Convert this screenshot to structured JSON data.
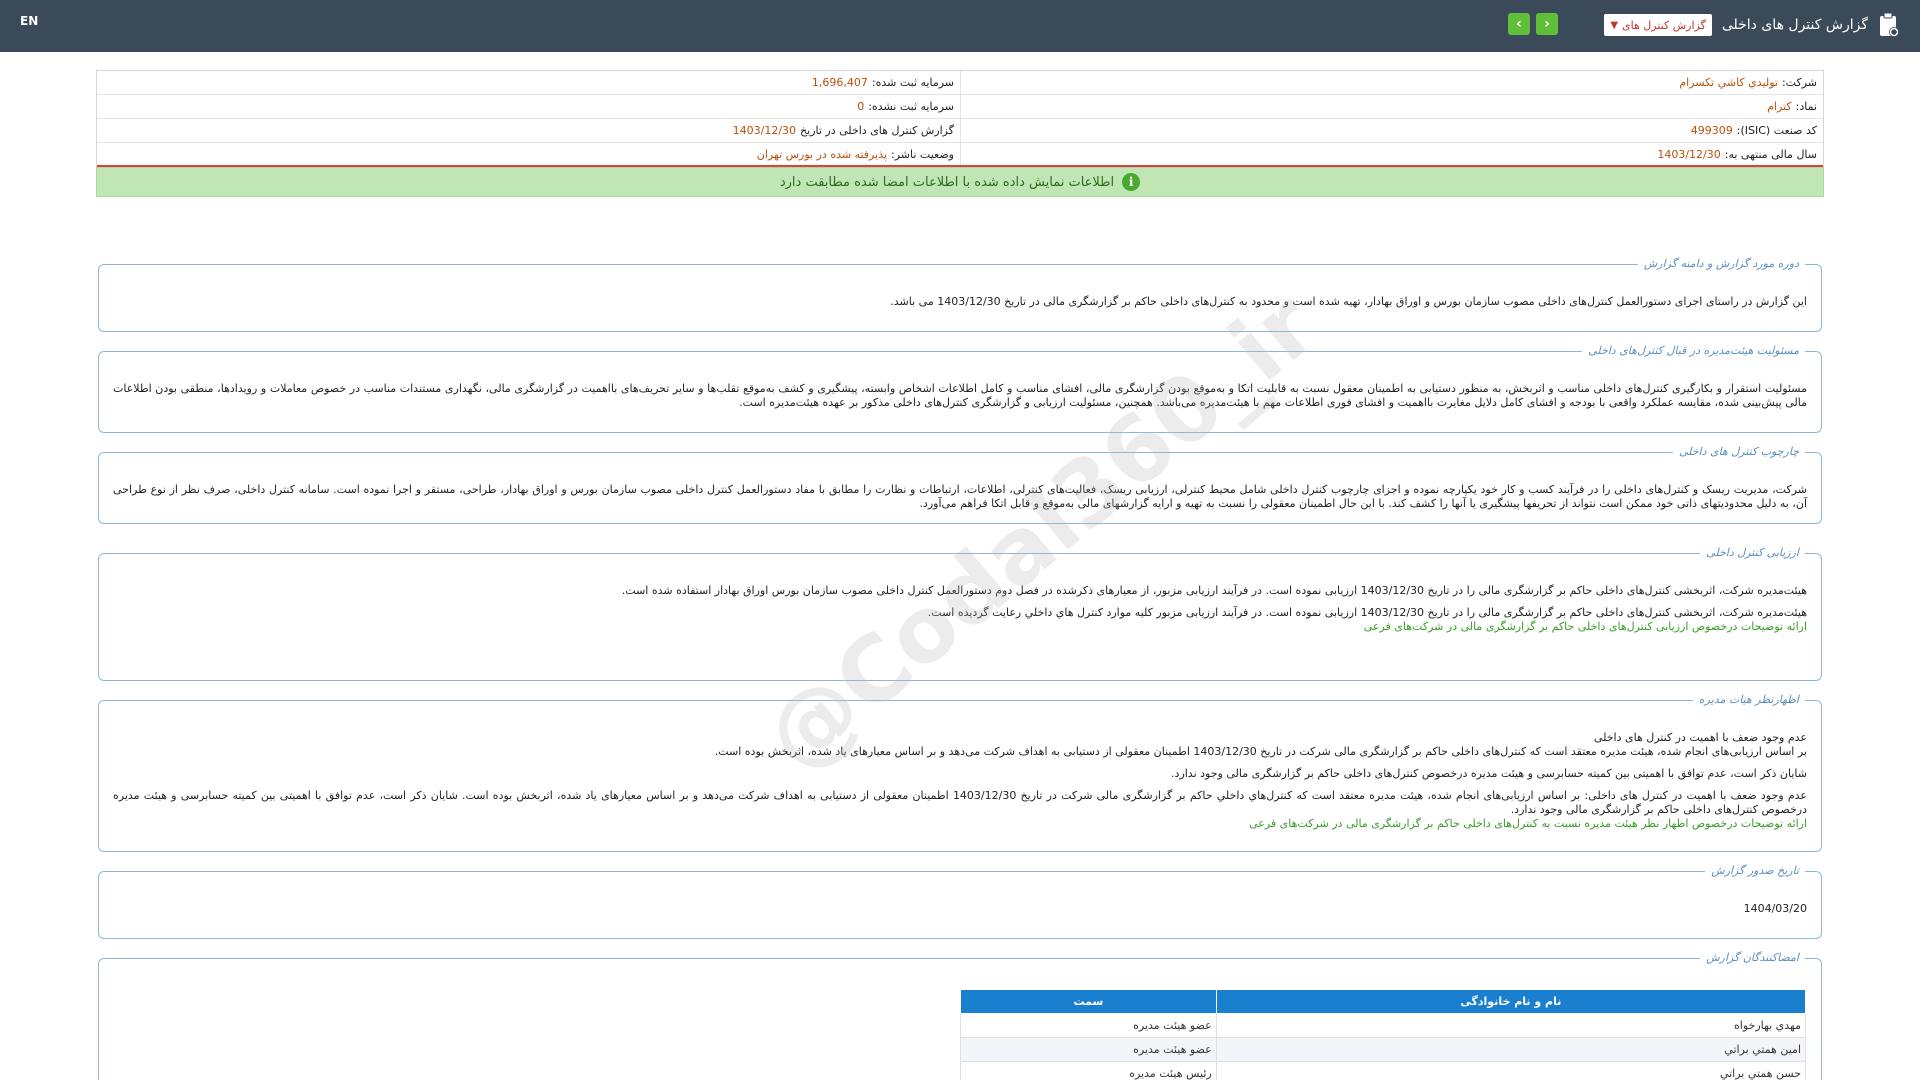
{
  "header": {
    "lang": "EN",
    "title": "گزارش کنترل های داخلی",
    "select_value": "گزارش کنترل های",
    "prev_icon": "chevron-left-icon",
    "next_icon": "chevron-right-icon"
  },
  "info": {
    "company_label": "شرکت:",
    "company_value": "توليدي كاشي تكسرام",
    "capital_reg_label": "سرمایه ثبت شده:",
    "capital_reg_value": "1,696,407",
    "symbol_label": "نماد:",
    "symbol_value": "کترام",
    "capital_unreg_label": "سرمایه ثبت نشده:",
    "capital_unreg_value": "0",
    "isic_label": "کد صنعت (ISIC):",
    "isic_value": "499309",
    "report_label": "گزارش کنترل های داخلی در تاریخ",
    "report_value": "1403/12/30",
    "fiscal_label": "سال مالی منتهی به:",
    "fiscal_value": "1403/12/30",
    "status_label": "وضعیت ناشر:",
    "status_value": "پذیرفته شده در بورس تهران"
  },
  "notice": {
    "text": "اطلاعات نمایش داده شده با اطلاعات امضا شده مطابقت دارد"
  },
  "sections": {
    "period": {
      "legend": "دوره مورد گزارش و دامنه گزارش",
      "text": "این گزارش در راستای اجرای دستورالعمل کنترل‌های داخلی مصوب سازمان بورس و اوراق بهادار، تهیه شده است و محدود به کنترل‌های داخلی حاکم بر گزارشگری مالی در تاریخ 1403/12/30 می باشد."
    },
    "board": {
      "legend": "مسئولیت هیئت‌مدیره در قبال کنترل‌های داخلی",
      "text": "مسئولیت استقرار و بکارگیری کنترل‌های داخلی مناسب و اثربخش، به منظور دستیابی به اطمینان معقول نسبت به قابلیت اتکا و به‌موقع بودن گزارشگری مالی، افشای مناسب و کامل اطلاعات اشخاص وابسته، پیشگیری و کشف به‌موقع تقلب‌ها و سایر تحریف‌های بااهمیت در گزارشگری مالی، نگهداری مستندات مناسب در خصوص معاملات و رویدادها، منطقی بودن اطلاعات مالی پیش‌بینی شده، مقایسه عملکرد واقعی با بودجه و افشای کامل دلایل مغایرت بااهمیت و افشای فوری اطلاعات مهم با هیئت‌مدیره می‌باشد. همچنین، مسئولیت ارزیابی و گزارشگری کنترل‌های داخلی مذکور بر عهده هیئت‌مدیره است."
    },
    "framework": {
      "legend": "چارچوب کنترل های داخلی",
      "text": "شرکت، مدیریت ریسک و کنترل‌های داخلی را در فرآیند کسب و کار خود یکپارچه نموده و اجزای چارچوب کنترل داخلی شامل محیط کنترلی، ارزیابی ریسک، فعالیت‌های کنترلی، اطلاعات، ارتباطات و نظارت را مطابق با مفاد دستورالعمل کنترل داخلی مصوب سازمان بورس و اوراق بهادار، طراحی، مستقر و اجرا نموده است. سامانه کنترل داخلی، صرف نظر از نوع طراحی آن، به دلیل محدودیتهای ذاتی خود ممکن است نتواند از تحریفها پیشگیری یا آنها را کشف کند. با این حال اطمینان معقولی را نسبت به تهیه و ارایه گزارشهای مالی به‌موقع و قابل اتکا فراهم می‌آورد."
    },
    "assessment": {
      "legend": "ارزیابی کنترل داخلی",
      "p1": "هیئت‌مدیره شرکت، اثربخشی کنترل‌های داخلی حاکم بر گزارشگری مالی را در تاریخ 1403/12/30 ارزیابی نموده است. در فرآیند ارزیابی مزبور، از معیارهای ذکرشده در فصل دوم دستورالعمل کنترل داخلی مصوب سازمان بورس اوراق بهادار استفاده شده است.",
      "p2": "هیئت‌مدیره شرکت، اثربخشی کنترل‌های داخلی حاکم بر گزارشگری مالی را در تاریخ 1403/12/30 ارزیابی نموده است. در فرآیند ارزیابی مزبور کلیه موارد کنترل هاي داخلي رعايت گرديده است.",
      "link": "ارائه توضیحات درخصوص ارزیابی کنترل‌های داخلی حاکم بر گزارشگری مالی در شرکت‌های فرعی"
    },
    "opinion": {
      "legend": "اظهارنظر هیات مدیره",
      "p1": "عدم وجود ضعف با اهمیت در کنترل های داخلی",
      "p2": "بر اساس ارزیابی‌های انجام شده، هیئت مدیره معتقد است که کنترل‌های داخلی حاکم بر گزارشگری مالی شرکت در تاریخ 1403/12/30 اطمینان معقولی از دستیابی به اهداف شرکت می‌دهد و بر اساس معیارهای یاد شده، اثربخش بوده است.",
      "p3": "شایان ذکر است، عدم توافق با اهمیتی بین کمیته حسابرسی و هیئت مدیره درخصوص کنترل‌های داخلی حاکم بر گزارشگری مالی وجود ندارد.",
      "p4": "عدم وجود ضعف با اهمیت در کنترل های داخلی: بر اساس ارزیابی‌های انجام شده، هیئت مدیره معتقد است که کنترل‌هاي داخلي حاکم بر گزارشگری مالی شرکت در تاریخ 1403/12/30 اطمینان معقولی از دستیابی به اهداف شرکت می‌دهد و بر اساس معیارهای یاد شده، اثربخش بوده است. شایان ذکر است، عدم توافق با اهمیتی بین کمیته حسابرسی و هیئت مدیره درخصوص کنترل‌های داخلی حاکم بر گزارشگری مالی وجود ندارد.",
      "link": "ارائه توضیحات درخصوص اظهار نظر هیئت مدیره نسبت به کنترل‌های داخلی حاکم بر گزارشگری مالی در شرکت‌های فرعی"
    },
    "issue_date": {
      "legend": "تاریخ صدور گزارش",
      "value": "1404/03/20"
    },
    "signers": {
      "legend": "امضاکنندگان گزارش",
      "col_name": "نام و نام خانوادگی",
      "col_position": "سمت",
      "rows": [
        {
          "name": "مهدي بهارخواه",
          "position": "عضو هیئت مدیره"
        },
        {
          "name": "امین همتي براتي",
          "position": "عضو هیئت مدیره"
        },
        {
          "name": "حسن همتي براتي",
          "position": "رئیس هیئت مدیره"
        }
      ]
    }
  },
  "watermark": "@Codal360_ir"
}
